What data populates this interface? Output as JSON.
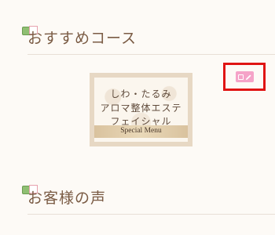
{
  "sections": [
    {
      "title": "おすすめコース"
    },
    {
      "title": "お客様の声"
    }
  ],
  "menu_card": {
    "lines": [
      "しわ・たるみ",
      "アロマ整体エステ",
      "フェイシャル"
    ],
    "ribbon_label": "Special Menu"
  },
  "icons": {
    "section_icon": "section-icon",
    "edit": "pencil-icon"
  },
  "colors": {
    "highlight": "#e01414",
    "edit_button": "#f5a3c8"
  }
}
